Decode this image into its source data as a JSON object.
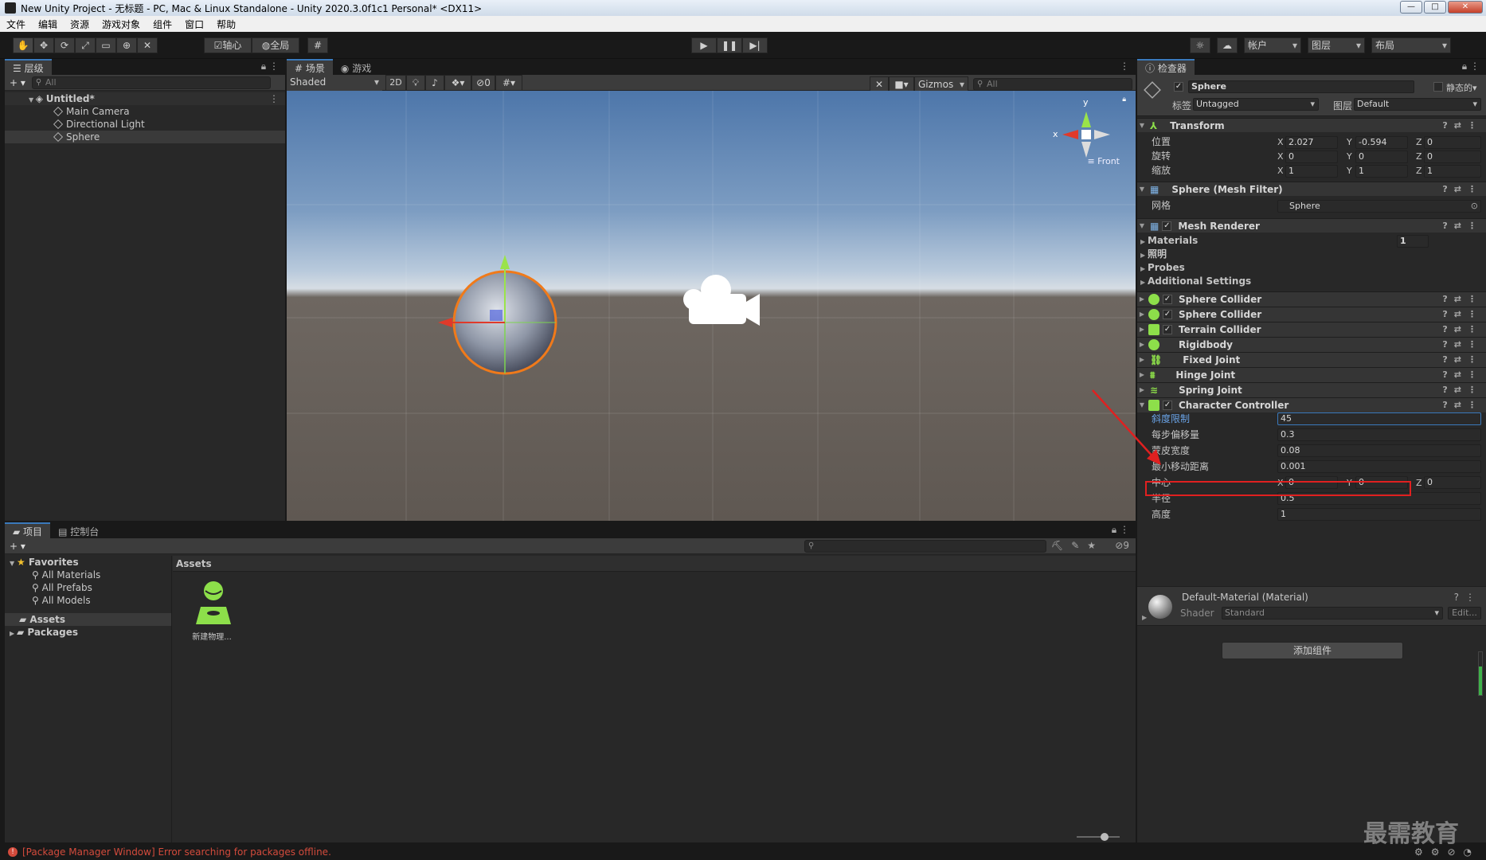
{
  "window": {
    "title": "New Unity Project - 无标题 - PC, Mac & Linux Standalone - Unity 2020.3.0f1c1 Personal* <DX11>",
    "minimize": "—",
    "maximize": "□",
    "close": "✕"
  },
  "menu": [
    "文件",
    "编辑",
    "资源",
    "游戏对象",
    "组件",
    "窗口",
    "帮助"
  ],
  "toolbar": {
    "pivot": "轴心",
    "global": "全局",
    "account": "帐户",
    "layers": "图层",
    "layout": "布局"
  },
  "hierarchy": {
    "tab": "层级",
    "search_placeholder": "All",
    "scene": "Untitled*",
    "items": [
      "Main Camera",
      "Directional Light",
      "Sphere"
    ]
  },
  "scene_view": {
    "tabs": [
      "场景",
      "游戏"
    ],
    "shading": "Shaded",
    "mode_2d": "2D",
    "hidden_count": "0",
    "gizmos": "Gizmos",
    "search_placeholder": "All",
    "axis_y": "y",
    "axis_x": "x",
    "view_label": "Front"
  },
  "project": {
    "tabs": [
      "项目",
      "控制台"
    ],
    "favorites": "Favorites",
    "fav_items": [
      "All Materials",
      "All Prefabs",
      "All Models"
    ],
    "roots": [
      "Assets",
      "Packages"
    ],
    "breadcrumb": "Assets",
    "asset_name": "新建物理...",
    "hidden_count": "9"
  },
  "inspector": {
    "tab": "检查器",
    "object_name": "Sphere",
    "static_label": "静态的",
    "tag_label": "标签",
    "tag_value": "Untagged",
    "layer_label": "图层",
    "layer_value": "Default",
    "transform": {
      "title": "Transform",
      "rows": [
        {
          "label": "位置",
          "x": "2.027",
          "y": "-0.594",
          "z": "0"
        },
        {
          "label": "旋转",
          "x": "0",
          "y": "0",
          "z": "0"
        },
        {
          "label": "缩放",
          "x": "1",
          "y": "1",
          "z": "1"
        }
      ]
    },
    "mesh_filter": {
      "title": "Sphere (Mesh Filter)",
      "mesh_label": "网格",
      "mesh_value": "Sphere"
    },
    "mesh_renderer": {
      "title": "Mesh Renderer",
      "sections": [
        "Materials",
        "照明",
        "Probes",
        "Additional Settings"
      ],
      "materials_count": "1"
    },
    "components": [
      "Sphere Collider",
      "Sphere Collider",
      "Terrain Collider",
      "Rigidbody",
      "Fixed Joint",
      "Hinge Joint",
      "Spring Joint"
    ],
    "character_controller": {
      "title": "Character Controller",
      "rows": [
        {
          "label": "斜度限制",
          "value": "45"
        },
        {
          "label": "每步偏移量",
          "value": "0.3"
        },
        {
          "label": "蒙皮宽度",
          "value": "0.08"
        },
        {
          "label": "最小移动距离",
          "value": "0.001"
        }
      ],
      "center_label": "中心",
      "center": {
        "x": "0",
        "y": "0",
        "z": "0"
      },
      "radius_label": "半径",
      "radius_value": "0.5",
      "height_label": "高度",
      "height_value": "1"
    },
    "material": {
      "title": "Default-Material (Material)",
      "shader_label": "Shader",
      "shader_value": "Standard",
      "edit": "Edit..."
    },
    "add_component": "添加组件"
  },
  "watermark": "最需教育",
  "status": {
    "error": "[Package Manager Window] Error searching for packages offline."
  },
  "colors": {
    "accent": "#3a79bb",
    "highlight_box": "#e02020",
    "arrow": "#e02020",
    "error": "#d34b3c"
  }
}
